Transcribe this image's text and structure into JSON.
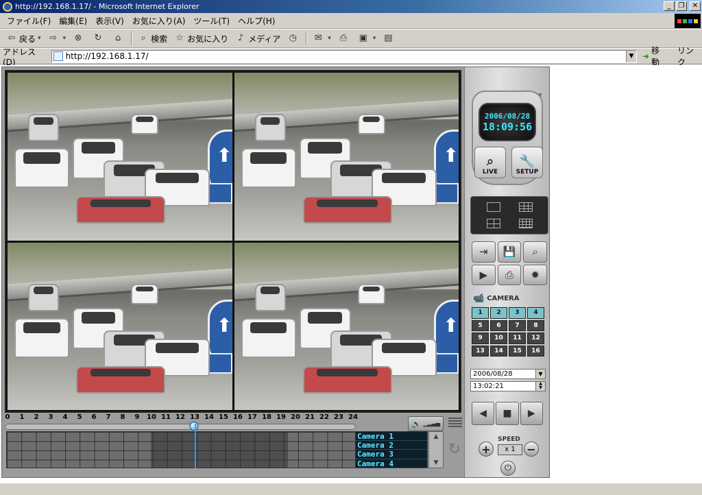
{
  "window": {
    "title": "http://192.168.1.17/ - Microsoft Internet Explorer"
  },
  "menu": [
    "ファイル(F)",
    "編集(E)",
    "表示(V)",
    "お気に入り(A)",
    "ツール(T)",
    "ヘルプ(H)"
  ],
  "toolbar": {
    "back": "戻る",
    "search": "検索",
    "favorites": "お気に入り",
    "media": "メディア"
  },
  "address": {
    "label": "アドレス(D)",
    "url": "http://192.168.1.17/",
    "go": "移動",
    "links": "リンク"
  },
  "timeline": {
    "hours": [
      "0",
      "1",
      "2",
      "3",
      "4",
      "5",
      "6",
      "7",
      "8",
      "9",
      "10",
      "11",
      "12",
      "13",
      "14",
      "15",
      "16",
      "17",
      "18",
      "19",
      "20",
      "21",
      "22",
      "23",
      "24"
    ],
    "cameras": [
      "Camera 1",
      "Camera 2",
      "Camera 3",
      "Camera 4"
    ],
    "position_hour": 13
  },
  "panel": {
    "date": "2006/08/28",
    "time": "18:09:56",
    "live_label": "LIVE",
    "setup_label": "SETUP",
    "camera_label": "CAMERA",
    "camera_buttons": [
      "1",
      "2",
      "3",
      "4",
      "5",
      "6",
      "7",
      "8",
      "9",
      "10",
      "11",
      "12",
      "13",
      "14",
      "15",
      "16"
    ],
    "active_cameras": [
      "1",
      "2",
      "3",
      "4"
    ],
    "search_date": "2006/08/28",
    "search_time": "13:02:21",
    "speed_label": "SPEED",
    "speed_value": "x 1"
  }
}
